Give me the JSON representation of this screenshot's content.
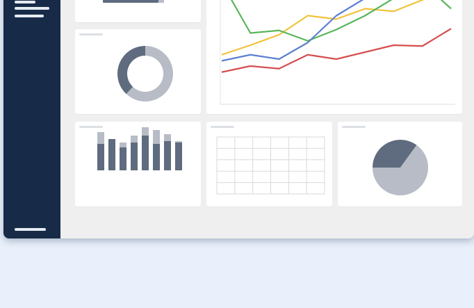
{
  "colors": {
    "background": "#e9f0fb",
    "sidebar": "#172b48",
    "panel": "#efefef",
    "card": "#ffffff",
    "dark_gray": "#5f6b7e",
    "light_gray": "#b7bcc6",
    "line_blue": "#5b7fd1",
    "line_yellow": "#f2c23b",
    "line_green": "#58b65a",
    "line_red": "#d54e4f"
  },
  "icons": {
    "menu": "hamburger-menu-icon"
  },
  "chart_data": [
    {
      "type": "pie",
      "title": "",
      "donut": true,
      "values": [
        62,
        38
      ],
      "colors": [
        "#b7bcc6",
        "#5f6b7e"
      ]
    },
    {
      "type": "line",
      "title": "",
      "x": [
        1,
        2,
        3,
        4,
        5,
        6,
        7,
        8,
        9
      ],
      "ylim": [
        0,
        100
      ],
      "series": [
        {
          "color": "#f2c23b",
          "values": [
            25,
            36,
            48,
            70,
            66,
            78,
            75,
            88,
            108
          ]
        },
        {
          "color": "#58b65a",
          "values": [
            108,
            50,
            53,
            41,
            54,
            70,
            90,
            108,
            78
          ]
        },
        {
          "color": "#5b7fd1",
          "values": [
            18,
            25,
            20,
            39,
            70,
            90,
            105,
            110,
            112
          ]
        },
        {
          "color": "#d54e4f",
          "values": [
            5,
            12,
            9,
            25,
            20,
            28,
            36,
            35,
            55
          ]
        }
      ]
    },
    {
      "type": "bar",
      "title": "",
      "stacked": true,
      "values": [
        55,
        45,
        40,
        50,
        62,
        58,
        52,
        42
      ],
      "series": [
        {
          "values": [
            38,
            45,
            33,
            40,
            50,
            38,
            42,
            40
          ]
        },
        {
          "values": [
            17,
            0,
            7,
            10,
            12,
            20,
            10,
            2
          ]
        }
      ]
    },
    {
      "type": "table",
      "title": "",
      "rows": 5,
      "columns": 6
    },
    {
      "type": "pie",
      "title": "",
      "values": [
        35,
        65
      ],
      "colors": [
        "#5f6b7e",
        "#b7bcc6"
      ]
    }
  ]
}
